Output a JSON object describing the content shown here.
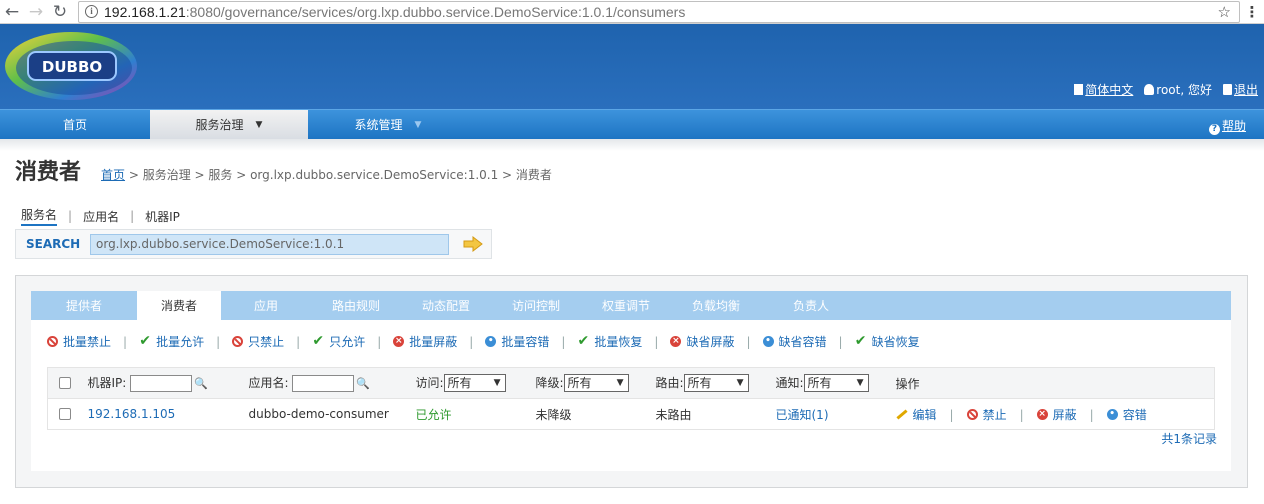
{
  "browser": {
    "url_host": "192.168.1.21",
    "url_rest": ":8080/governance/services/org.lxp.dubbo.service.DemoService:1.0.1/consumers"
  },
  "header": {
    "logo_text": "DUBBO",
    "lang_label": "简体中文",
    "user_label": "root, 您好",
    "logout_label": "退出"
  },
  "menu": {
    "items": [
      {
        "label": "首页"
      },
      {
        "label": "服务治理",
        "active": true
      },
      {
        "label": "系统管理"
      }
    ],
    "help_label": "帮助"
  },
  "page": {
    "title": "消费者",
    "breadcrumb": {
      "home": "首页",
      "rest": " > 服务治理 > 服务 > org.lxp.dubbo.service.DemoService:1.0.1 > 消费者"
    }
  },
  "search": {
    "tabs": [
      "服务名",
      "应用名",
      "机器IP"
    ],
    "label": "SEARCH",
    "value": "org.lxp.dubbo.service.DemoService:1.0.1"
  },
  "tabs": [
    "提供者",
    "消费者",
    "应用",
    "路由规则",
    "动态配置",
    "访问控制",
    "权重调节",
    "负载均衡",
    "负责人"
  ],
  "actions": [
    {
      "label": "批量禁止",
      "icon": "ban-icon"
    },
    {
      "label": "批量允许",
      "icon": "check-icon"
    },
    {
      "label": "只禁止",
      "icon": "ban-icon"
    },
    {
      "label": "只允许",
      "icon": "check-icon"
    },
    {
      "label": "批量屏蔽",
      "icon": "x-circle-icon"
    },
    {
      "label": "批量容错",
      "icon": "gear-icon"
    },
    {
      "label": "批量恢复",
      "icon": "check-icon"
    },
    {
      "label": "缺省屏蔽",
      "icon": "x-circle-icon"
    },
    {
      "label": "缺省容错",
      "icon": "gear-icon"
    },
    {
      "label": "缺省恢复",
      "icon": "check-icon"
    }
  ],
  "table": {
    "headers": {
      "ip": "机器IP:",
      "app": "应用名:",
      "access": "访问:",
      "degrade": "降级:",
      "route": "路由:",
      "notify": "通知:",
      "ops": "操作"
    },
    "filters": {
      "access": "所有",
      "degrade": "所有",
      "route": "所有",
      "notify": "所有"
    },
    "rows": [
      {
        "ip": "192.168.1.105",
        "app": "dubbo-demo-consumer",
        "access": "已允许",
        "degrade": "未降级",
        "route": "未路由",
        "notify": "已通知(1)",
        "ops": [
          "编辑",
          "禁止",
          "屏蔽",
          "容错"
        ]
      }
    ],
    "count": "共1条记录"
  }
}
